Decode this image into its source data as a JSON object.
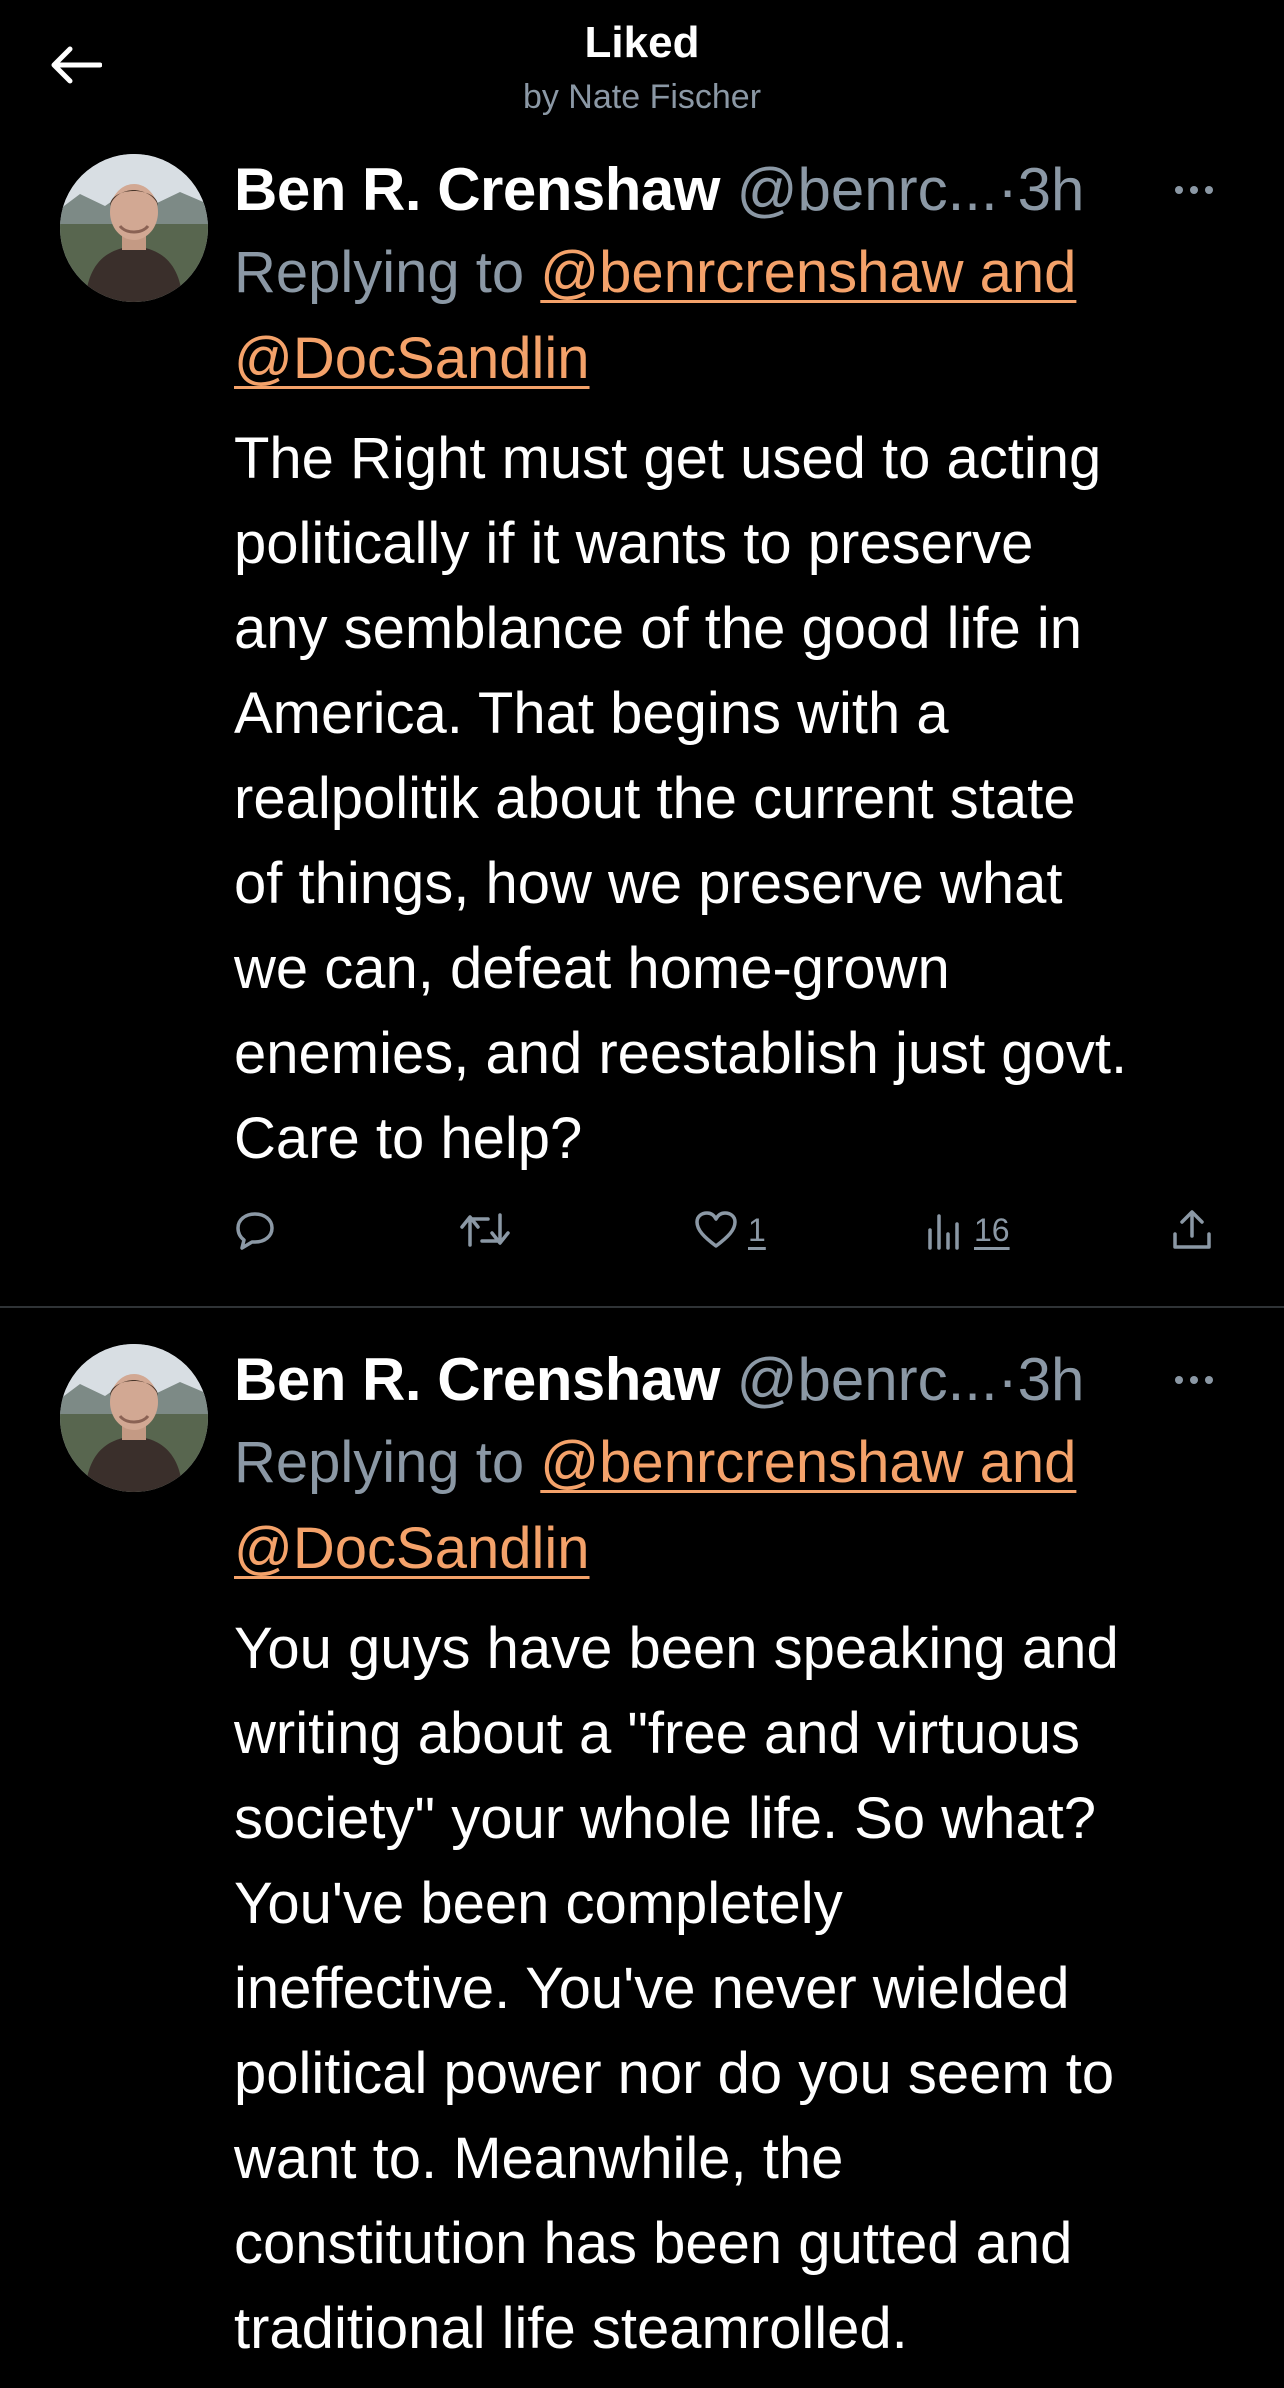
{
  "header": {
    "title": "Liked",
    "subtitle": "by Nate Fischer"
  },
  "colors": {
    "background": "#000000",
    "text": "#ffffff",
    "muted": "#8b98a5",
    "mention": "#f4a26a",
    "divider": "#2f3336"
  },
  "tweets": [
    {
      "author_name": "Ben R. Crenshaw",
      "author_handle": "@benrc...",
      "separator": "·",
      "time": "3h",
      "replying_prefix": "Replying to ",
      "replying_mention_1": "@benrcrenshaw and",
      "replying_mention_2": "@DocSandlin",
      "text": "The Right must get used to acting\npolitically if it wants to preserve\nany semblance of the good life in\nAmerica. That begins with a\nrealpolitik about the current state\nof things, how we preserve what\nwe can, defeat home-grown\nenemies, and reestablish just govt.\nCare to help?",
      "like_count": "1",
      "view_count": "16"
    },
    {
      "author_name": "Ben R. Crenshaw",
      "author_handle": "@benrc...",
      "separator": "·",
      "time": "3h",
      "replying_prefix": "Replying to ",
      "replying_mention_1": "@benrcrenshaw and",
      "replying_mention_2": "@DocSandlin",
      "text": "You guys have been speaking and\nwriting about a \"free and virtuous\nsociety\" your whole life. So what?\nYou've been completely\nineffective. You've never wielded\npolitical power nor do you seem to\nwant to. Meanwhile, the\nconstitution has been gutted and\ntraditional life steamrolled."
    }
  ],
  "icons": {
    "back": "arrow-left-icon",
    "more": "more-horizontal-icon",
    "reply": "reply-icon",
    "retweet": "retweet-icon",
    "like": "heart-icon",
    "views": "views-icon",
    "share": "share-icon"
  }
}
